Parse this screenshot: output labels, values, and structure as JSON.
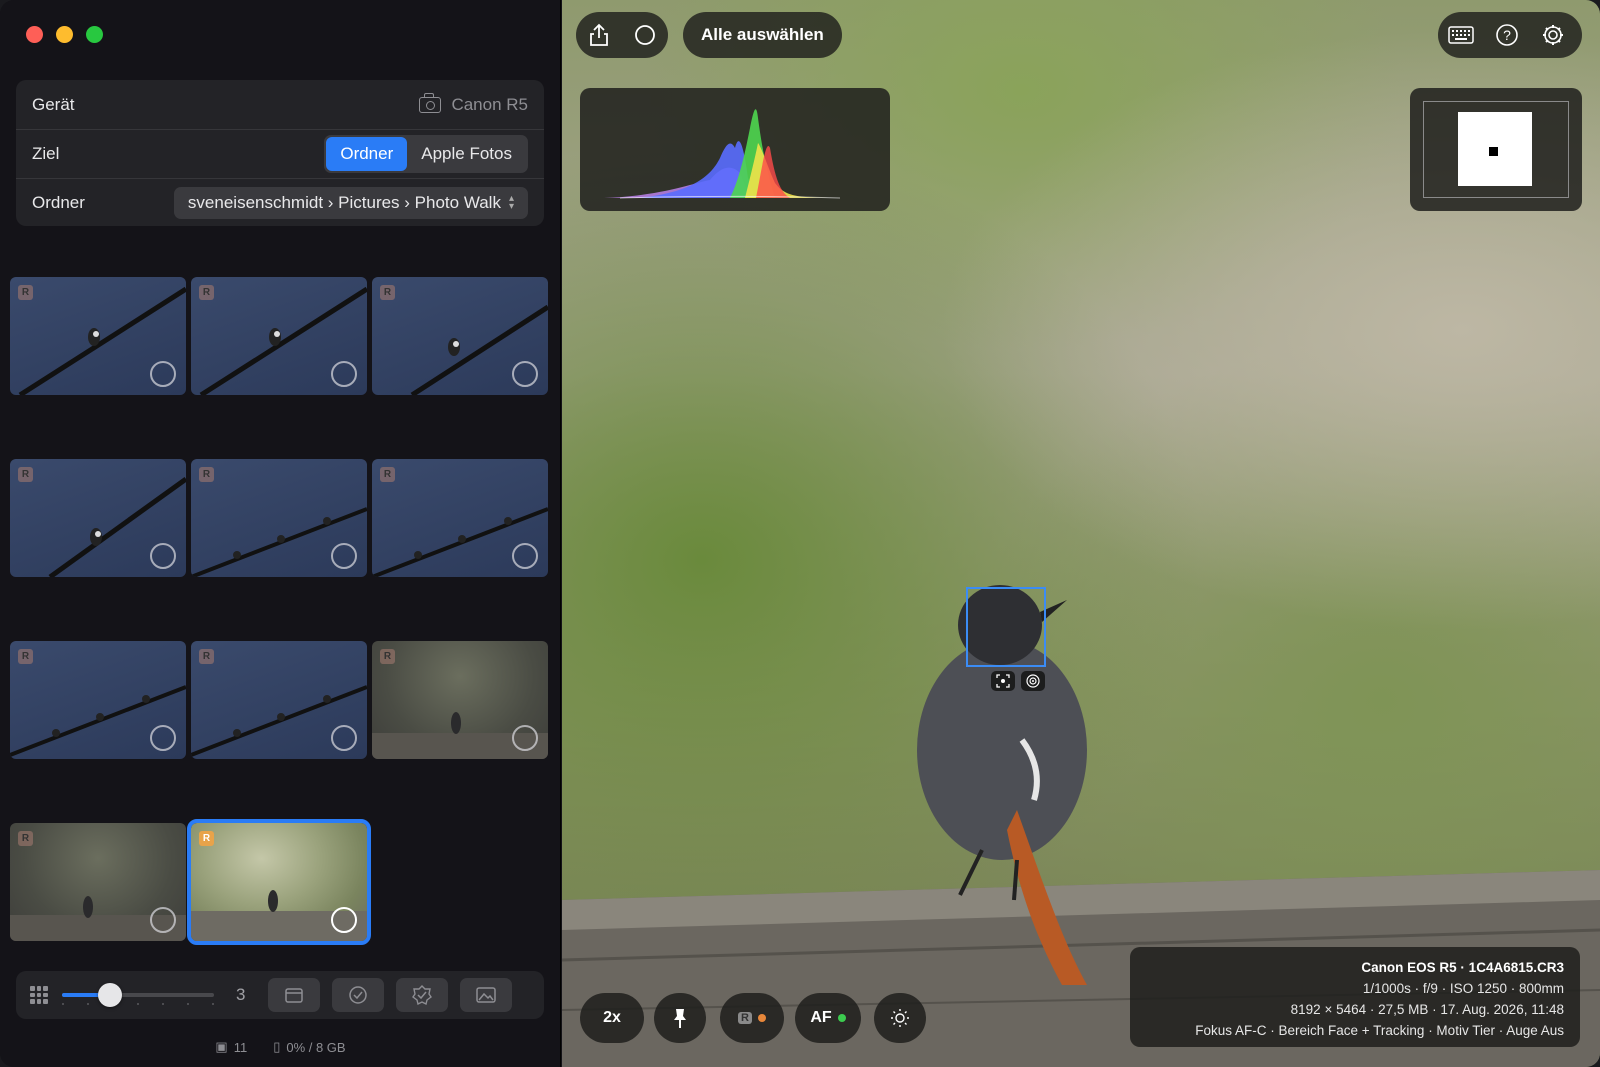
{
  "sidebar": {
    "device_label": "Gerät",
    "device_value": "Canon R5",
    "target_label": "Ziel",
    "target_options": [
      "Ordner",
      "Apple Fotos"
    ],
    "target_selected": "Ordner",
    "folder_label": "Ordner",
    "folder_path": "sveneisenschmidt › Pictures › Photo Walk",
    "thumb_badge": "R",
    "columns": "3",
    "footer_count": "11",
    "footer_storage": "0% / 8 GB"
  },
  "viewer": {
    "select_all": "Alle auswählen",
    "zoom": "2x",
    "raw_label": "R",
    "af_label": "AF",
    "info": {
      "line1": "Canon EOS R5 · 1C4A6815.CR3",
      "line2": "1/1000s · f/9 · ISO 1250 · 800mm",
      "line3": "8192 × 5464 · 27,5 MB · 17. Aug. 2026, 11:48",
      "line4": "Fokus AF-C · Bereich Face + Tracking · Motiv Tier · Auge Aus"
    }
  },
  "colors": {
    "accent": "#2a7cf6",
    "raw_dot": "#e8873a",
    "af_dot": "#3ccb4f"
  }
}
